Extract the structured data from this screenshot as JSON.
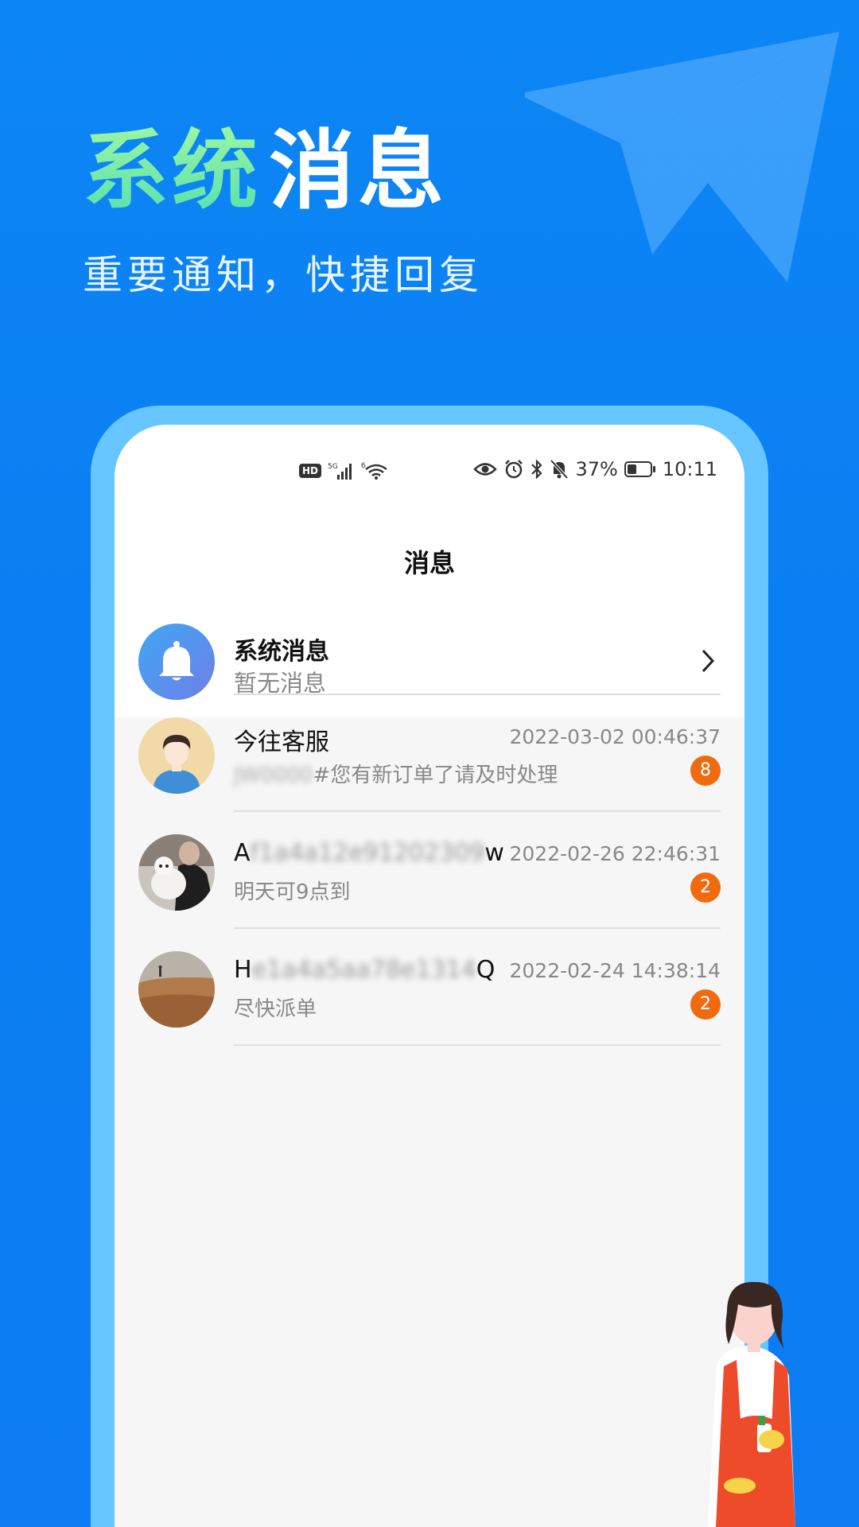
{
  "banner": {
    "title_highlight": "系统",
    "title_rest": "消息",
    "subtitle": "重要通知，快捷回复"
  },
  "status_bar": {
    "left_badge": "HD",
    "signal_label": "5G",
    "wifi_label": "6",
    "battery": "37%",
    "time": "10:11"
  },
  "nav": {
    "title": "消息"
  },
  "system_message": {
    "title": "系统消息",
    "subtitle": "暂无消息",
    "icon": "bell-icon"
  },
  "messages": [
    {
      "name_prefix": "今往客服",
      "name_blurred": "",
      "name_suffix": "",
      "time": "2022-03-02 00:46:37",
      "preview_blurred": "JW0000",
      "preview": "#您有新订单了请及时处理",
      "badge": "8"
    },
    {
      "name_prefix": "A",
      "name_blurred": "f1a4a12e91202309",
      "name_suffix": "w",
      "time": "2022-02-26 22:46:31",
      "preview_blurred": "",
      "preview": "明天可9点到",
      "badge": "2"
    },
    {
      "name_prefix": "H",
      "name_blurred": "e1a4a5aa78e1314",
      "name_suffix": "Q",
      "time": "2022-02-24 14:38:14",
      "preview_blurred": "",
      "preview": "尽快派单",
      "badge": "2"
    }
  ],
  "colors": {
    "background": "#0d86f5",
    "phone_frame": "#67c6ff",
    "badge": "#f06b10"
  }
}
